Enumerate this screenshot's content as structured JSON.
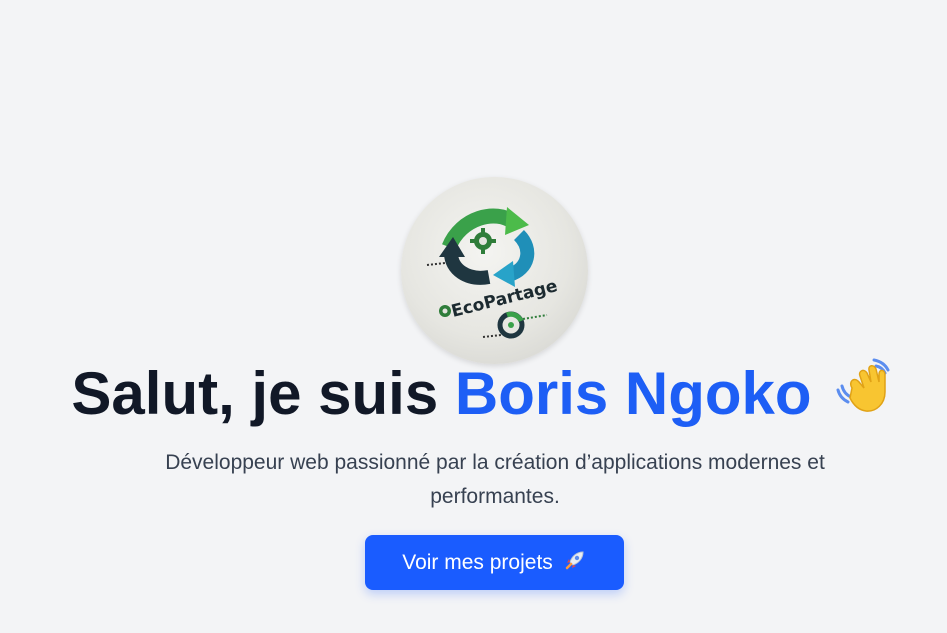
{
  "hero": {
    "avatar_logo_text": "EcoPartage",
    "greeting_prefix": "Salut, je suis",
    "name": "Boris Ngoko",
    "wave_icon": "waving-hand-icon",
    "subtitle": "Développeur web passionné par la création d’applications modernes et performantes.",
    "cta_label": "Voir mes projets",
    "cta_icon": "rocket-icon"
  },
  "colors": {
    "background": "#f3f4f6",
    "heading": "#111827",
    "accent": "#1d5ef5",
    "button": "#1a5cff",
    "subtitle": "#374151"
  }
}
